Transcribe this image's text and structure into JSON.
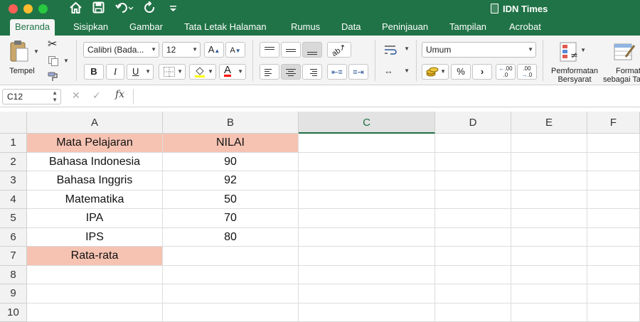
{
  "titlebar": {
    "title": "IDN Times",
    "icons": [
      "home-icon",
      "save-icon",
      "undo-icon",
      "redo-icon",
      "customize-icon"
    ],
    "color": "#207346"
  },
  "tabs": [
    {
      "label": "Beranda",
      "active": true
    },
    {
      "label": "Sisipkan"
    },
    {
      "label": "Gambar"
    },
    {
      "label": "Tata Letak Halaman"
    },
    {
      "label": "Rumus"
    },
    {
      "label": "Data"
    },
    {
      "label": "Peninjauan"
    },
    {
      "label": "Tampilan"
    },
    {
      "label": "Acrobat"
    }
  ],
  "ribbon": {
    "paste_label": "Tempel",
    "font_name": "Calibri (Bada...",
    "font_size": "12",
    "increase_font": "A",
    "decrease_font": "A",
    "bold": "B",
    "italic": "I",
    "underline": "U",
    "font_color_letter": "A",
    "number_format": "Umum",
    "percent": "%",
    "comma": "›",
    "increase_decimal": ".00",
    "decrease_decimal": ".0",
    "conditional_formatting": [
      "Pemformatan",
      "Bersyarat"
    ],
    "format_as_table": [
      "Format",
      "sebagai Ta"
    ],
    "fill_color": "#ffff00",
    "font_color": "#ff0000"
  },
  "formula_bar": {
    "name_box": "C12",
    "fx": "fx",
    "content": ""
  },
  "sheet": {
    "columns": [
      "A",
      "B",
      "C",
      "D",
      "E",
      "F"
    ],
    "selected_column": "C",
    "rows": [
      "1",
      "2",
      "3",
      "4",
      "5",
      "6",
      "7",
      "8",
      "9",
      "10"
    ],
    "cells": [
      [
        "Mata Pelajaran",
        "NILAI"
      ],
      [
        "Bahasa Indonesia",
        "90"
      ],
      [
        "Bahasa Inggris",
        "92"
      ],
      [
        "Matematika",
        "50"
      ],
      [
        "IPA",
        "70"
      ],
      [
        "IPS",
        "80"
      ],
      [
        "Rata-rata",
        ""
      ],
      [
        "",
        ""
      ],
      [
        "",
        ""
      ],
      [
        "",
        ""
      ]
    ],
    "highlight_color": "#f6c3b2"
  }
}
